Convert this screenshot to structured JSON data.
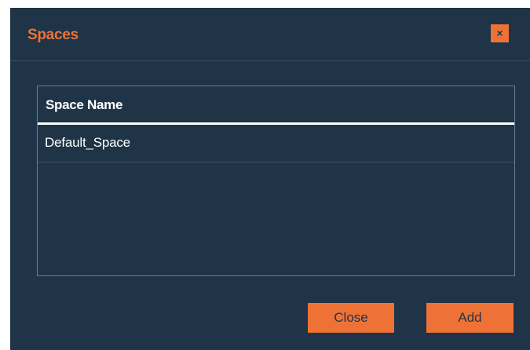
{
  "dialog": {
    "title": "Spaces",
    "close_icon": "×"
  },
  "table": {
    "columns": [
      "Space Name"
    ],
    "rows": [
      [
        "Default_Space"
      ]
    ]
  },
  "footer": {
    "close_label": "Close",
    "add_label": "Add"
  },
  "colors": {
    "background": "#1f3447",
    "accent": "#ee7236",
    "text": "#ffffff"
  }
}
